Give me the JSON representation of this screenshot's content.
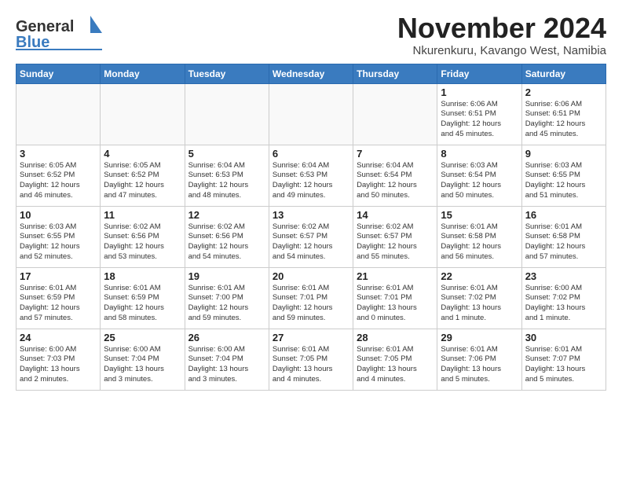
{
  "logo": {
    "part1": "General",
    "part2": "Blue"
  },
  "title": "November 2024",
  "location": "Nkurenkuru, Kavango West, Namibia",
  "days_of_week": [
    "Sunday",
    "Monday",
    "Tuesday",
    "Wednesday",
    "Thursday",
    "Friday",
    "Saturday"
  ],
  "weeks": [
    [
      {
        "day": "",
        "info": ""
      },
      {
        "day": "",
        "info": ""
      },
      {
        "day": "",
        "info": ""
      },
      {
        "day": "",
        "info": ""
      },
      {
        "day": "",
        "info": ""
      },
      {
        "day": "1",
        "info": "Sunrise: 6:06 AM\nSunset: 6:51 PM\nDaylight: 12 hours\nand 45 minutes."
      },
      {
        "day": "2",
        "info": "Sunrise: 6:06 AM\nSunset: 6:51 PM\nDaylight: 12 hours\nand 45 minutes."
      }
    ],
    [
      {
        "day": "3",
        "info": "Sunrise: 6:05 AM\nSunset: 6:52 PM\nDaylight: 12 hours\nand 46 minutes."
      },
      {
        "day": "4",
        "info": "Sunrise: 6:05 AM\nSunset: 6:52 PM\nDaylight: 12 hours\nand 47 minutes."
      },
      {
        "day": "5",
        "info": "Sunrise: 6:04 AM\nSunset: 6:53 PM\nDaylight: 12 hours\nand 48 minutes."
      },
      {
        "day": "6",
        "info": "Sunrise: 6:04 AM\nSunset: 6:53 PM\nDaylight: 12 hours\nand 49 minutes."
      },
      {
        "day": "7",
        "info": "Sunrise: 6:04 AM\nSunset: 6:54 PM\nDaylight: 12 hours\nand 50 minutes."
      },
      {
        "day": "8",
        "info": "Sunrise: 6:03 AM\nSunset: 6:54 PM\nDaylight: 12 hours\nand 50 minutes."
      },
      {
        "day": "9",
        "info": "Sunrise: 6:03 AM\nSunset: 6:55 PM\nDaylight: 12 hours\nand 51 minutes."
      }
    ],
    [
      {
        "day": "10",
        "info": "Sunrise: 6:03 AM\nSunset: 6:55 PM\nDaylight: 12 hours\nand 52 minutes."
      },
      {
        "day": "11",
        "info": "Sunrise: 6:02 AM\nSunset: 6:56 PM\nDaylight: 12 hours\nand 53 minutes."
      },
      {
        "day": "12",
        "info": "Sunrise: 6:02 AM\nSunset: 6:56 PM\nDaylight: 12 hours\nand 54 minutes."
      },
      {
        "day": "13",
        "info": "Sunrise: 6:02 AM\nSunset: 6:57 PM\nDaylight: 12 hours\nand 54 minutes."
      },
      {
        "day": "14",
        "info": "Sunrise: 6:02 AM\nSunset: 6:57 PM\nDaylight: 12 hours\nand 55 minutes."
      },
      {
        "day": "15",
        "info": "Sunrise: 6:01 AM\nSunset: 6:58 PM\nDaylight: 12 hours\nand 56 minutes."
      },
      {
        "day": "16",
        "info": "Sunrise: 6:01 AM\nSunset: 6:58 PM\nDaylight: 12 hours\nand 57 minutes."
      }
    ],
    [
      {
        "day": "17",
        "info": "Sunrise: 6:01 AM\nSunset: 6:59 PM\nDaylight: 12 hours\nand 57 minutes."
      },
      {
        "day": "18",
        "info": "Sunrise: 6:01 AM\nSunset: 6:59 PM\nDaylight: 12 hours\nand 58 minutes."
      },
      {
        "day": "19",
        "info": "Sunrise: 6:01 AM\nSunset: 7:00 PM\nDaylight: 12 hours\nand 59 minutes."
      },
      {
        "day": "20",
        "info": "Sunrise: 6:01 AM\nSunset: 7:01 PM\nDaylight: 12 hours\nand 59 minutes."
      },
      {
        "day": "21",
        "info": "Sunrise: 6:01 AM\nSunset: 7:01 PM\nDaylight: 13 hours\nand 0 minutes."
      },
      {
        "day": "22",
        "info": "Sunrise: 6:01 AM\nSunset: 7:02 PM\nDaylight: 13 hours\nand 1 minute."
      },
      {
        "day": "23",
        "info": "Sunrise: 6:00 AM\nSunset: 7:02 PM\nDaylight: 13 hours\nand 1 minute."
      }
    ],
    [
      {
        "day": "24",
        "info": "Sunrise: 6:00 AM\nSunset: 7:03 PM\nDaylight: 13 hours\nand 2 minutes."
      },
      {
        "day": "25",
        "info": "Sunrise: 6:00 AM\nSunset: 7:04 PM\nDaylight: 13 hours\nand 3 minutes."
      },
      {
        "day": "26",
        "info": "Sunrise: 6:00 AM\nSunset: 7:04 PM\nDaylight: 13 hours\nand 3 minutes."
      },
      {
        "day": "27",
        "info": "Sunrise: 6:01 AM\nSunset: 7:05 PM\nDaylight: 13 hours\nand 4 minutes."
      },
      {
        "day": "28",
        "info": "Sunrise: 6:01 AM\nSunset: 7:05 PM\nDaylight: 13 hours\nand 4 minutes."
      },
      {
        "day": "29",
        "info": "Sunrise: 6:01 AM\nSunset: 7:06 PM\nDaylight: 13 hours\nand 5 minutes."
      },
      {
        "day": "30",
        "info": "Sunrise: 6:01 AM\nSunset: 7:07 PM\nDaylight: 13 hours\nand 5 minutes."
      }
    ]
  ]
}
